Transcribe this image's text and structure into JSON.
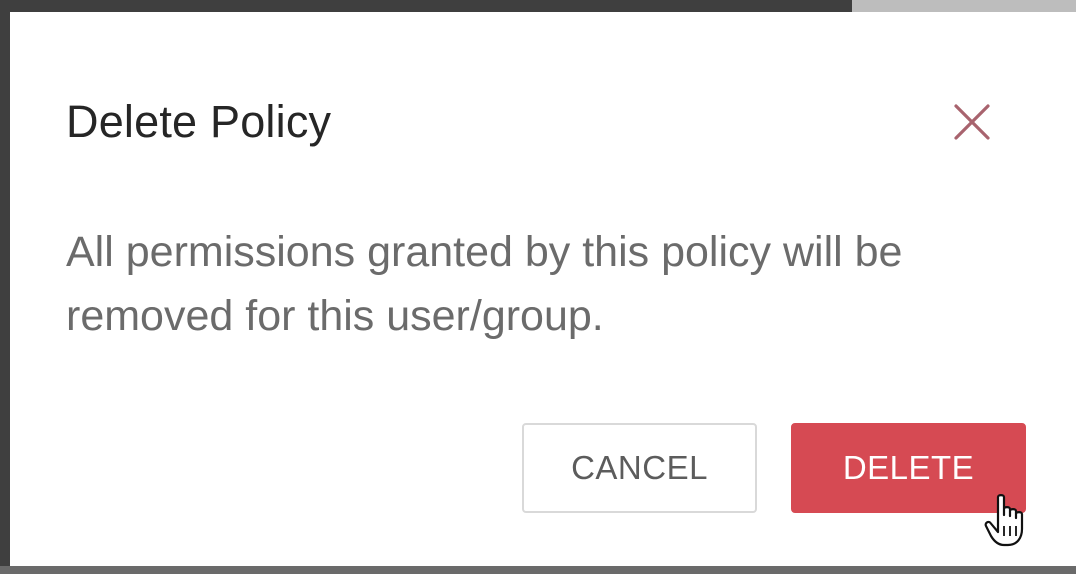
{
  "dialog": {
    "title": "Delete Policy",
    "message": "All permissions granted by this policy will be removed for this user/group.",
    "close_icon": "close-icon",
    "cancel_label": "CANCEL",
    "delete_label": "DELETE"
  },
  "colors": {
    "title": "#262626",
    "message": "#6b6b6b",
    "close_icon": "#a8636e",
    "delete_button": "#d64a53",
    "cancel_border": "#d9d9d9"
  },
  "cursor": {
    "icon": "hand-pointer-cursor-icon"
  }
}
